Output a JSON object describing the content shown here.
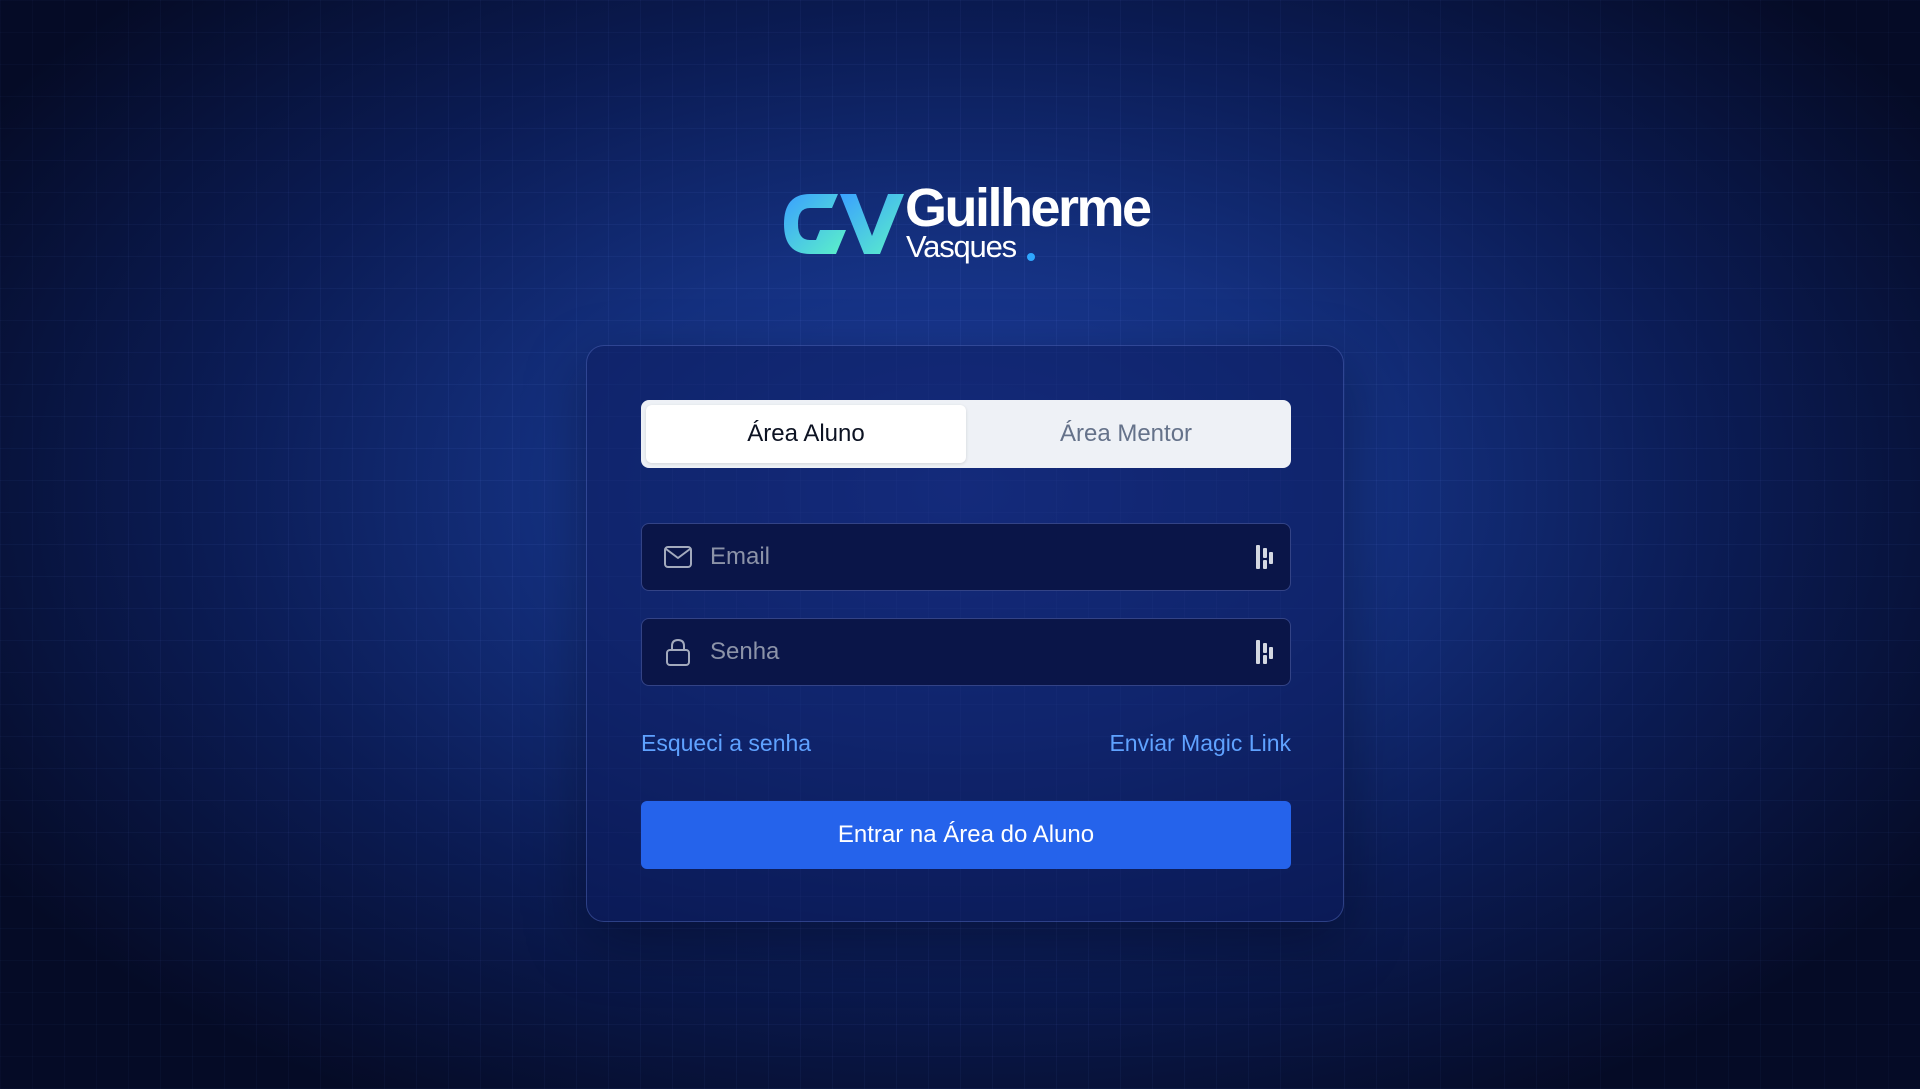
{
  "brand": {
    "monogram": "GV",
    "name_line1": "Guilherme",
    "name_line2": "Vasques",
    "colors": {
      "logo_gradient_start": "#3aa0ff",
      "logo_gradient_end": "#5cf2c8",
      "dot": "#2ea7ff"
    }
  },
  "login": {
    "tabs": [
      {
        "label": "Área Aluno",
        "active": true
      },
      {
        "label": "Área Mentor",
        "active": false
      }
    ],
    "email": {
      "icon": "mail-icon",
      "placeholder": "Email",
      "value": ""
    },
    "password": {
      "icon": "lock-icon",
      "placeholder": "Senha",
      "value": ""
    },
    "forgot_link": "Esqueci a senha",
    "magic_link": "Enviar Magic Link",
    "submit_label": "Entrar na Área do Aluno"
  },
  "colors": {
    "accent": "#2563eb",
    "link": "#5fa2ff",
    "background": "#14307f"
  }
}
